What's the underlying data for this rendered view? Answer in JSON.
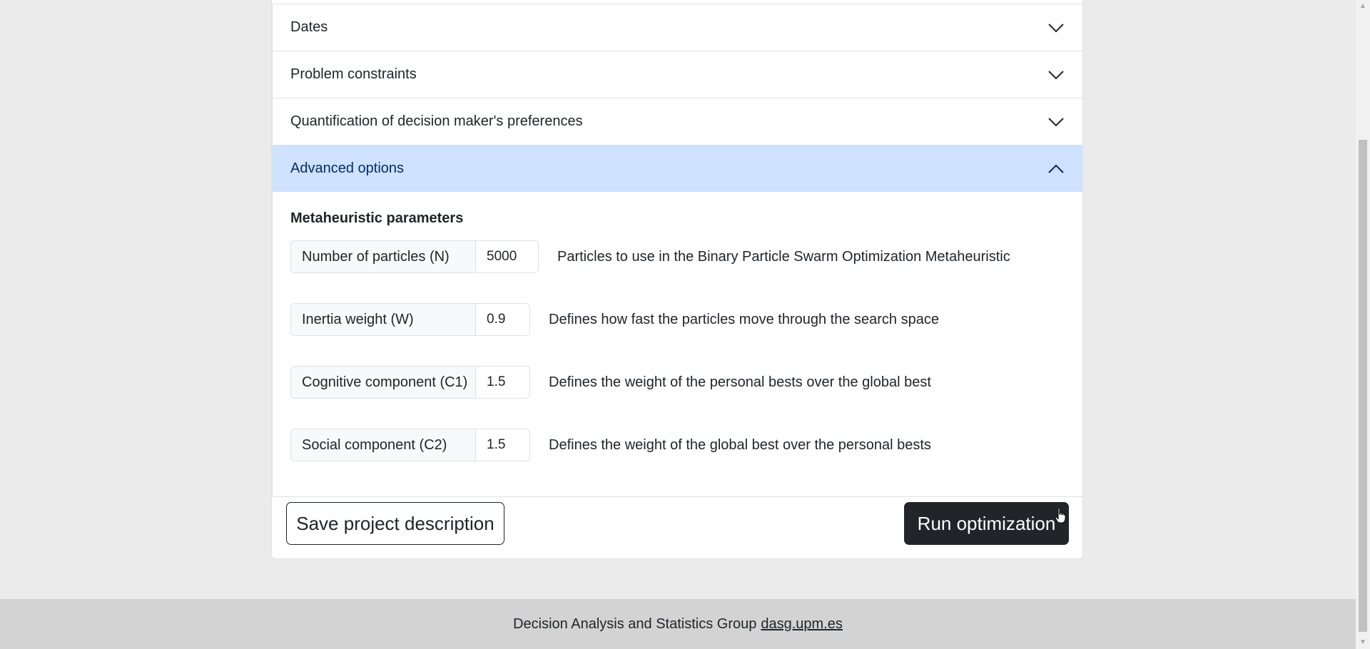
{
  "accordion": {
    "items": [
      {
        "label": "Dates",
        "expanded": false
      },
      {
        "label": "Problem constraints",
        "expanded": false
      },
      {
        "label": "Quantification of decision maker's preferences",
        "expanded": false
      },
      {
        "label": "Advanced options",
        "expanded": true
      }
    ]
  },
  "advanced": {
    "section_title": "Metaheuristic parameters",
    "params": [
      {
        "label": "Number of particles (N)",
        "value": "5000",
        "description": "Particles to use in the Binary Particle Swarm Optimization Metaheuristic"
      },
      {
        "label": "Inertia weight (W)",
        "value": "0.9",
        "description": "Defines how fast the particles move through the search space"
      },
      {
        "label": "Cognitive component (C1)",
        "value": "1.5",
        "description": "Defines the weight of the personal bests over the global best"
      },
      {
        "label": "Social component (C2)",
        "value": "1.5",
        "description": "Defines the weight of the global best over the personal bests"
      }
    ]
  },
  "actions": {
    "save_label": "Save project description",
    "run_label": "Run optimization"
  },
  "footer": {
    "text": "Decision Analysis and Statistics Group",
    "link": "dasg.upm.es"
  },
  "colors": {
    "active_header_bg": "#cfe2ff",
    "dark_button": "#212529",
    "footer_bg": "#d3d3d3",
    "page_bg": "#ebebeb"
  },
  "icons": {
    "collapsed": "chevron-down-icon",
    "expanded": "chevron-up-icon",
    "cursor": "hand-pointer-icon"
  }
}
